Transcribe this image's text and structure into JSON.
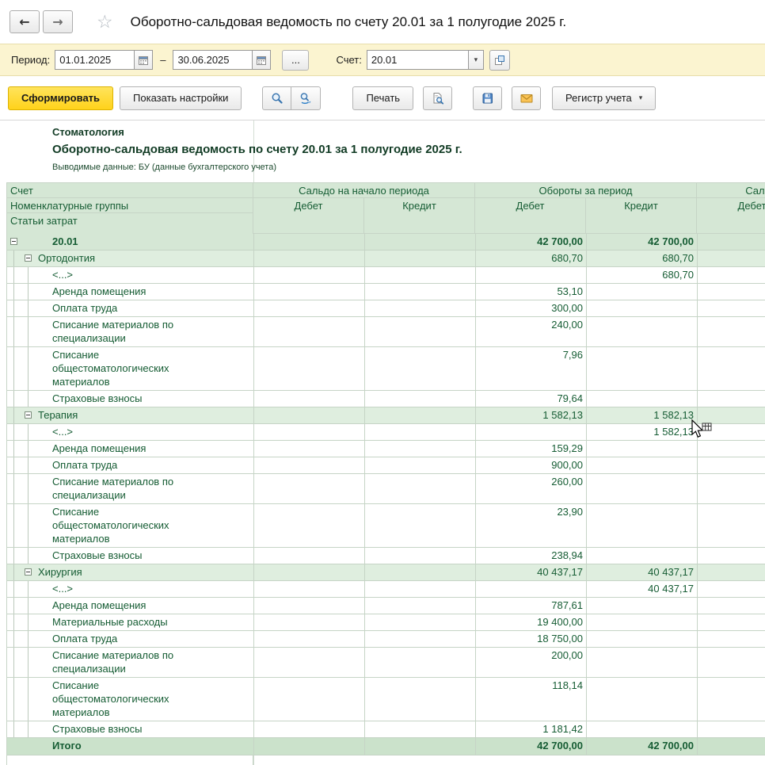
{
  "window": {
    "title": "Оборотно-сальдовая ведомость по счету 20.01 за 1 полугодие 2025 г.",
    "icons": {
      "back": "←",
      "forward": "→",
      "star": "☆"
    }
  },
  "filter": {
    "period_label": "Период:",
    "date_from": "01.01.2025",
    "range_dash": "–",
    "date_to": "30.06.2025",
    "more_label": "...",
    "account_label": "Счет:",
    "account_value": "20.01",
    "dropdown_glyph": "▾",
    "icons": {
      "calendar": "calendar-icon",
      "open": "open-form-icon"
    }
  },
  "toolbar": {
    "generate_label": "Сформировать",
    "show_settings_label": "Показать настройки",
    "print_label": "Печать",
    "register_label": "Регистр учета",
    "caret_glyph": "▾",
    "icons": [
      "magnifier-icon",
      "magnifier-repeat-icon",
      "print-preview-icon",
      "floppy-save-icon",
      "envelope-icon"
    ]
  },
  "report": {
    "org": "Стоматология",
    "title": "Оборотно-сальдовая ведомость по счету 20.01 за 1 полугодие 2025 г.",
    "subtitle": "Выводимые данные: БУ (данные бухгалтерского учета)",
    "header": {
      "left_lines": [
        "Счет",
        "Номенклатурные группы",
        "Статьи затрат"
      ],
      "groups": [
        "Сальдо на начало периода",
        "Обороты за период",
        "Сальдо на конец периода"
      ],
      "sub_columns": [
        "Дебет",
        "Кредит"
      ]
    },
    "rows": [
      {
        "name": "20.01",
        "type": "account",
        "expander": true,
        "values": [
          "",
          "",
          "42 700,00",
          "42 700,00",
          "",
          ""
        ]
      },
      {
        "name": "Ортодонтия",
        "type": "group",
        "expander": true,
        "values": [
          "",
          "",
          "680,70",
          "680,70",
          "",
          ""
        ]
      },
      {
        "name": "<...>",
        "type": "detail",
        "values": [
          "",
          "",
          "",
          "680,70",
          "",
          ""
        ]
      },
      {
        "name": "Аренда помещения",
        "type": "detail",
        "values": [
          "",
          "",
          "53,10",
          "",
          "",
          ""
        ]
      },
      {
        "name": "Оплата труда",
        "type": "detail",
        "values": [
          "",
          "",
          "300,00",
          "",
          "",
          ""
        ]
      },
      {
        "name": "Списание материалов по специализации",
        "type": "detail",
        "values": [
          "",
          "",
          "240,00",
          "",
          "",
          ""
        ]
      },
      {
        "name": "Списание общестоматологических материалов",
        "type": "detail",
        "values": [
          "",
          "",
          "7,96",
          "",
          "",
          ""
        ]
      },
      {
        "name": "Страховые взносы",
        "type": "detail",
        "values": [
          "",
          "",
          "79,64",
          "",
          "",
          ""
        ]
      },
      {
        "name": "Терапия",
        "type": "group",
        "expander": true,
        "values": [
          "",
          "",
          "1 582,13",
          "1 582,13",
          "",
          ""
        ]
      },
      {
        "name": "<...>",
        "type": "detail",
        "values": [
          "",
          "",
          "",
          "1 582,13",
          "",
          ""
        ]
      },
      {
        "name": "Аренда помещения",
        "type": "detail",
        "values": [
          "",
          "",
          "159,29",
          "",
          "",
          ""
        ]
      },
      {
        "name": "Оплата труда",
        "type": "detail",
        "values": [
          "",
          "",
          "900,00",
          "",
          "",
          ""
        ]
      },
      {
        "name": "Списание материалов по специализации",
        "type": "detail",
        "values": [
          "",
          "",
          "260,00",
          "",
          "",
          ""
        ]
      },
      {
        "name": "Списание общестоматологических материалов",
        "type": "detail",
        "values": [
          "",
          "",
          "23,90",
          "",
          "",
          ""
        ]
      },
      {
        "name": "Страховые взносы",
        "type": "detail",
        "values": [
          "",
          "",
          "238,94",
          "",
          "",
          ""
        ]
      },
      {
        "name": "Хирургия",
        "type": "group",
        "expander": true,
        "values": [
          "",
          "",
          "40 437,17",
          "40 437,17",
          "",
          ""
        ]
      },
      {
        "name": "<...>",
        "type": "detail",
        "values": [
          "",
          "",
          "",
          "40 437,17",
          "",
          ""
        ]
      },
      {
        "name": "Аренда помещения",
        "type": "detail",
        "values": [
          "",
          "",
          "787,61",
          "",
          "",
          ""
        ]
      },
      {
        "name": "Материальные расходы",
        "type": "detail",
        "values": [
          "",
          "",
          "19 400,00",
          "",
          "",
          ""
        ]
      },
      {
        "name": "Оплата труда",
        "type": "detail",
        "values": [
          "",
          "",
          "18 750,00",
          "",
          "",
          ""
        ]
      },
      {
        "name": "Списание материалов по специализации",
        "type": "detail",
        "values": [
          "",
          "",
          "200,00",
          "",
          "",
          ""
        ]
      },
      {
        "name": "Списание общестоматологических материалов",
        "type": "detail",
        "values": [
          "",
          "",
          "118,14",
          "",
          "",
          ""
        ]
      },
      {
        "name": "Страховые взносы",
        "type": "detail",
        "values": [
          "",
          "",
          "1 181,42",
          "",
          "",
          ""
        ]
      },
      {
        "name": "Итого",
        "type": "total",
        "expander": false,
        "values": [
          "",
          "",
          "42 700,00",
          "42 700,00",
          "",
          ""
        ]
      }
    ]
  },
  "colors": {
    "panel_yellow": "#fbf4d0",
    "panel_yellow_border": "#e7ddac",
    "generate_yellow_1": "#ffe45c",
    "generate_yellow_2": "#ffd21a",
    "generate_border": "#dcb200",
    "header_green": "#d5e7d5",
    "group_green": "#dfeedf",
    "total_green": "#cbe2cb",
    "grid": "#c6d4c6",
    "report_text": "#155c33",
    "button_border": "#b3b3b3",
    "icon_blue": "#3a76b0",
    "icon_orange": "#e9a63b"
  }
}
